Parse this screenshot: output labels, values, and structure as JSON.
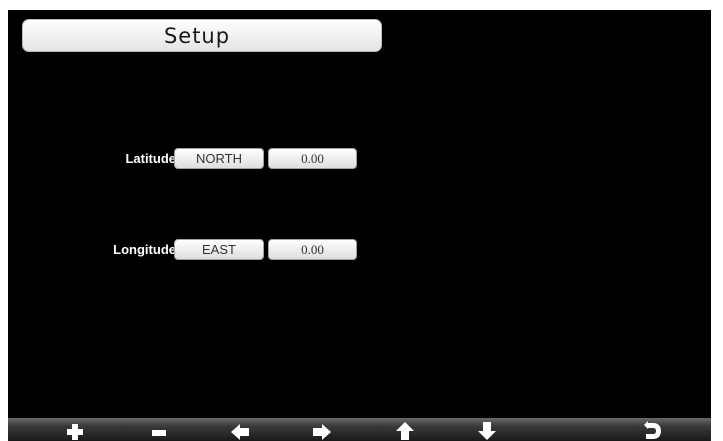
{
  "header": {
    "title": "Setup"
  },
  "fields": {
    "latitude": {
      "label": "Latitude",
      "direction": "NORTH",
      "value": "0.00"
    },
    "longitude": {
      "label": "Longitude",
      "direction": "EAST",
      "value": "0.00"
    }
  },
  "toolbar": {
    "buttons": [
      {
        "icon": "plus-icon"
      },
      {
        "icon": "minus-icon"
      },
      {
        "icon": "arrow-left-icon"
      },
      {
        "icon": "arrow-right-icon"
      },
      {
        "icon": "arrow-up-icon"
      },
      {
        "icon": "arrow-down-icon"
      },
      {
        "icon": "return-icon"
      }
    ]
  },
  "colors": {
    "background": "#000000",
    "panel": "#ffffff",
    "label_text": "#ffffff"
  }
}
